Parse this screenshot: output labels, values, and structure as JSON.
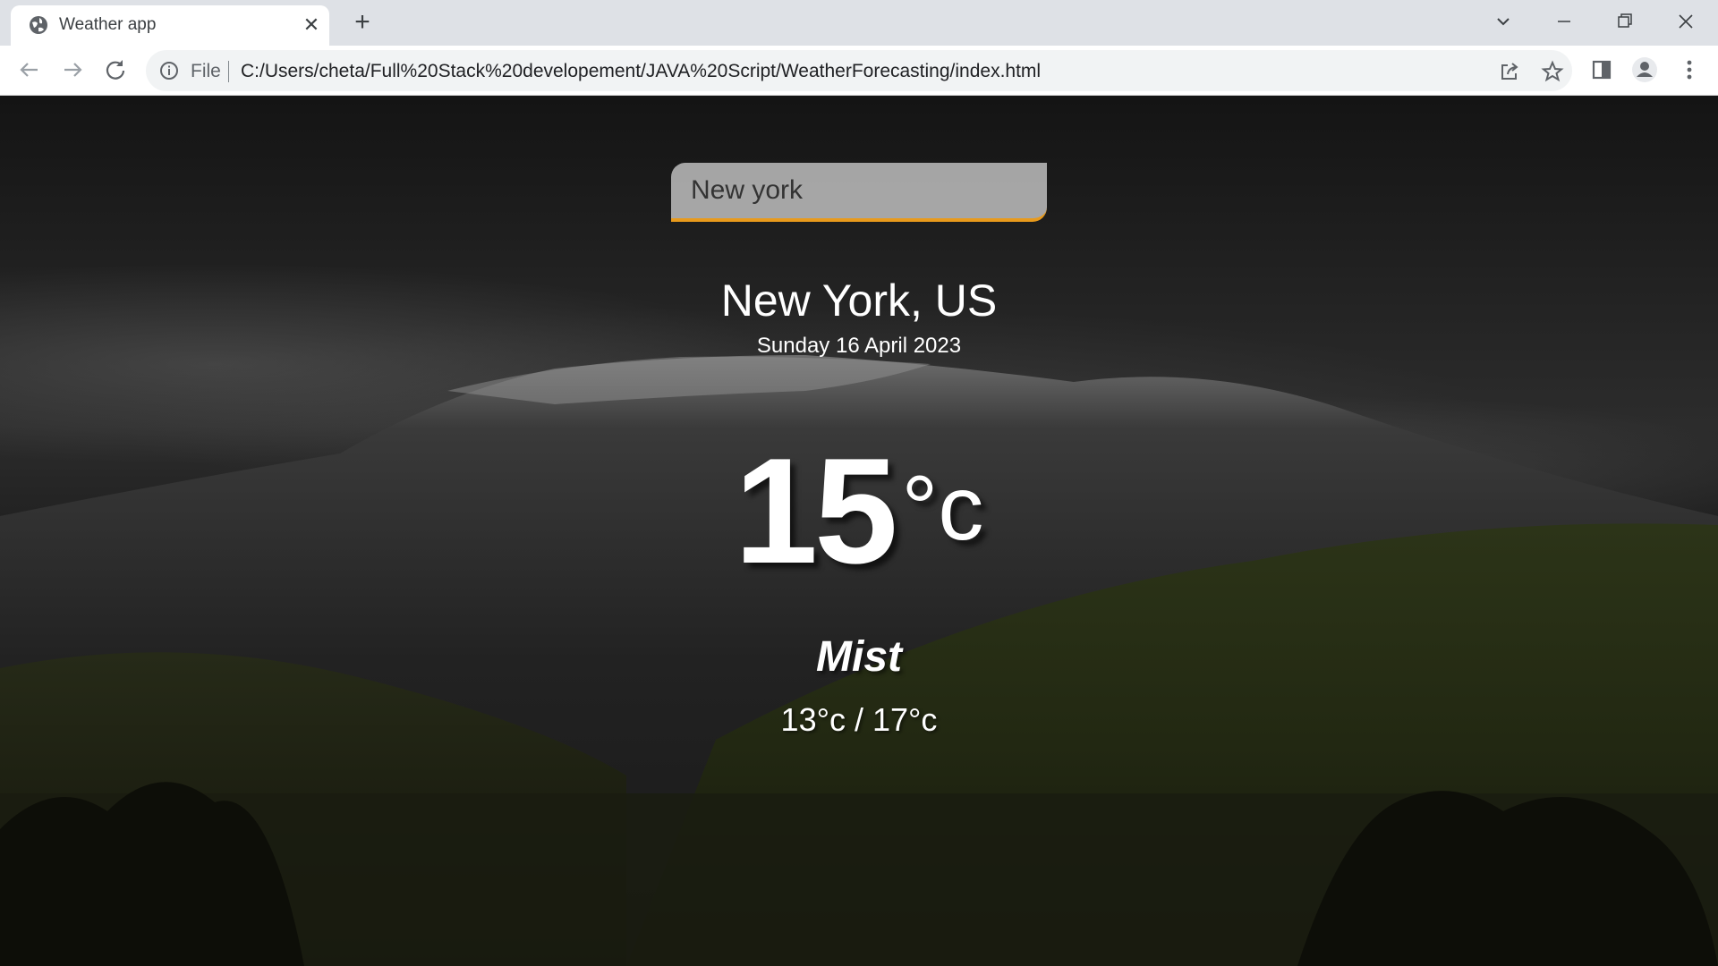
{
  "browser": {
    "tab": {
      "title": "Weather app",
      "favicon": "globe-icon"
    },
    "omnibox": {
      "scheme_label": "File",
      "url": "C:/Users/cheta/Full%20Stack%20developement/JAVA%20Script/WeatherForecasting/index.html"
    },
    "icons": [
      "back-arrow-icon",
      "forward-arrow-icon",
      "reload-icon",
      "info-icon",
      "share-icon",
      "star-icon",
      "side-panel-icon",
      "profile-icon",
      "more-menu-icon",
      "tab-search-icon",
      "minimize-icon",
      "restore-icon",
      "close-window-icon"
    ]
  },
  "app": {
    "search": {
      "value": "New york",
      "placeholder": ""
    },
    "location": "New York, US",
    "date": "Sunday 16 April 2023",
    "temperature": {
      "value": "15",
      "unit": "°c"
    },
    "condition": "Mist",
    "hi_low": "13°c / 17°c",
    "colors": {
      "accent": "#e89a1c",
      "text": "#ffffff"
    }
  }
}
